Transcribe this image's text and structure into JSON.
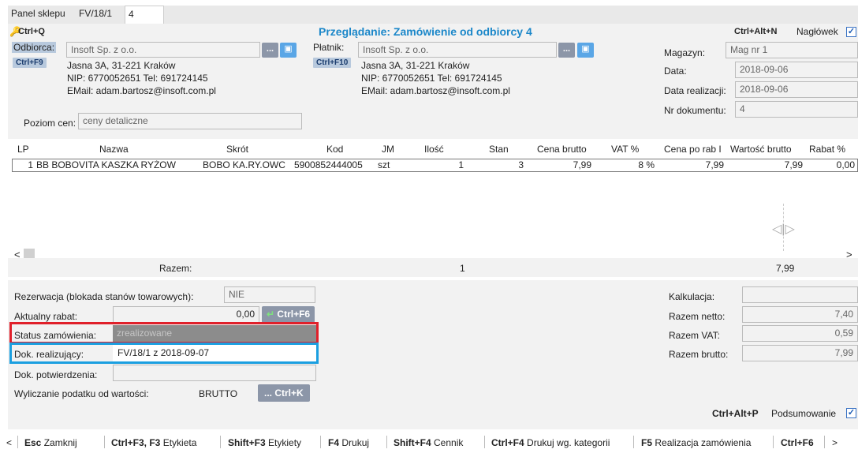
{
  "tabs": [
    {
      "label": "Panel sklepu"
    },
    {
      "label": "FV/18/1"
    },
    {
      "label": "4"
    }
  ],
  "header": {
    "ctrl_q": "Ctrl+Q",
    "title": "Przeglądanie: Zamówienie od odbiorcy 4",
    "ctrl_alt_n": "Ctrl+Alt+N",
    "naglowek_label": "Nagłówek",
    "naglowek_checked": "✓"
  },
  "odbiorca": {
    "label": "Odbiorca:",
    "value": "Insoft Sp. z o.o.",
    "shortcut": "Ctrl+F9",
    "address": "Jasna 3A, 31-221 Kraków",
    "nip": "NIP: 6770052651 Tel: 691724145",
    "email": "EMail: adam.bartosz@insoft.com.pl",
    "dots": "...",
    "icon": "card-icon"
  },
  "platnik": {
    "label": "Płatnik:",
    "value": "Insoft Sp. z o.o.",
    "shortcut": "Ctrl+F10",
    "address": "Jasna 3A, 31-221 Kraków",
    "nip": "NIP: 6770052651 Tel: 691724145",
    "email": "EMail: adam.bartosz@insoft.com.pl",
    "dots": "...",
    "icon": "card-icon"
  },
  "poziom_cen": {
    "label": "Poziom cen:",
    "value": "ceny detaliczne"
  },
  "right_fields": {
    "magazyn_label": "Magazyn:",
    "magazyn_value": "Mag nr 1",
    "data_label": "Data:",
    "data_value": "2018-09-06",
    "data_real_label": "Data realizacji:",
    "data_real_value": "2018-09-06",
    "nr_dok_label": "Nr dokumentu:",
    "nr_dok_value": "4"
  },
  "table": {
    "columns": [
      "LP",
      "Nazwa",
      "Skrót",
      "Kod",
      "JM",
      "Ilość",
      "Stan",
      "Cena brutto",
      "VAT %",
      "Cena po rab I",
      "Wartość brutto",
      "Rabat %"
    ],
    "rows": [
      [
        "1",
        "BB BOBOVITA KASZKA RYŻOW",
        "BOBO KA.RY.OWC",
        "5900852444005",
        "szt",
        "1",
        "3",
        "7,99",
        "8 %",
        "7,99",
        "7,99",
        "0,00"
      ]
    ],
    "totals_label": "Razem:",
    "totals_qty": "1",
    "totals_value": "7,99"
  },
  "bottom_left": {
    "rezerwacja_label": "Rezerwacja (blokada stanów towarowych):",
    "rezerwacja_value": "NIE",
    "rabat_label": "Aktualny rabat:",
    "rabat_value": "0,00",
    "rabat_shortcut": "Ctrl+F6",
    "status_label": "Status zamówienia:",
    "status_value": "zrealizowane",
    "dok_real_label": "Dok. realizujący:",
    "dok_real_value": "FV/18/1 z 2018-09-07",
    "dok_potw_label": "Dok. potwierdzenia:",
    "dok_potw_value": "",
    "podatek_label": "Wyliczanie podatku od wartości:",
    "podatek_value": "BRUTTO",
    "podatek_btn": "... Ctrl+K"
  },
  "bottom_right": {
    "kalkulacja_label": "Kalkulacja:",
    "kalkulacja_value": "",
    "netto_label": "Razem netto:",
    "netto_value": "7,40",
    "vat_label": "Razem VAT:",
    "vat_value": "0,59",
    "brutto_label": "Razem brutto:",
    "brutto_value": "7,99",
    "ctrl_alt_p": "Ctrl+Alt+P",
    "podsumowanie_label": "Podsumowanie",
    "podsumowanie_checked": "✓"
  },
  "bottom_bar": {
    "prev": "<",
    "next": ">",
    "items": [
      {
        "key": "Esc",
        "label": "Zamknij"
      },
      {
        "key": "Ctrl+F3, F3",
        "label": "Etykieta"
      },
      {
        "key": "Shift+F3",
        "label": "Etykiety"
      },
      {
        "key": "F4",
        "label": "Drukuj"
      },
      {
        "key": "Shift+F4",
        "label": "Cennik"
      },
      {
        "key": "Ctrl+F4",
        "label": "Drukuj wg. kategorii"
      },
      {
        "key": "F5",
        "label": "Realizacja zamówienia"
      },
      {
        "key": "Ctrl+F6",
        "label": ""
      }
    ]
  },
  "colors": {
    "title": "#1b87c9",
    "highlight_red": "#e0202a",
    "highlight_blue": "#1b9fe0",
    "panel_bg": "#f2f2f2"
  }
}
